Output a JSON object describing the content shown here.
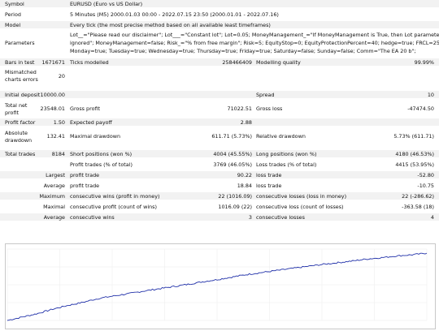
{
  "report": {
    "symbol_label": "Symbol",
    "symbol_value": "EURUSD (Euro vs US Dollar)",
    "period_label": "Period",
    "period_value": "5 Minutes (M5) 2000.01.03 00:00 - 2022.07.15 23:50 (2000.01.01 - 2022.07.16)",
    "model_label": "Model",
    "model_value": "Every tick (the most precise method based on all available least timeframes)",
    "parameters_label": "Parameters",
    "parameters_lines": [
      "Lot__=\"Please read our disclaimer\"; Lot___=\"Constant lot\"; Lot=0.05; MoneyManagement_=\"If MoneyManagement is True, then Lot parameter",
      "ignored\"; MoneyManagement=false; Risk_=\"% from free margin\"; Risk=5; EquityStop=0; EquityProtectionPercent=40; hedge=true; FRCL=25;",
      "Monday=true; Tuesday=true; Wednesday=true; Thursday=true; Friday=true; Saturday=false; Sunday=false; Comm=\"The EA 20 b\";"
    ],
    "bars_label": "Bars in test",
    "bars_value": "1671671",
    "ticks_label": "Ticks modelled",
    "ticks_value": "258466409",
    "quality_label": "Modelling quality",
    "quality_value": "99.99%",
    "mismatch_label_1": "Mismatched",
    "mismatch_label_2": "charts errors",
    "mismatch_value": "20",
    "deposit_label": "Initial deposit",
    "deposit_value": "10000.00",
    "spread_label": "Spread",
    "spread_value": "10",
    "netprofit_label_1": "Total net",
    "netprofit_label_2": "profit",
    "netprofit_value": "23548.01",
    "grossprofit_label": "Gross profit",
    "grossprofit_value": "71022.51",
    "grossloss_label": "Gross loss",
    "grossloss_value": "-47474.50",
    "pf_label": "Profit factor",
    "pf_value": "1.50",
    "payoff_label": "Expected payoff",
    "payoff_value": "2.88",
    "absdd_label_1": "Absolute",
    "absdd_label_2": "drawdown",
    "absdd_value": "132.41",
    "maxdd_label": "Maximal drawdown",
    "maxdd_value": "611.71 (5.73%)",
    "reldd_label": "Relative drawdown",
    "reldd_value": "5.73% (611.71)",
    "trades_label": "Total trades",
    "trades_value": "8184",
    "short_label": "Short positions (won %)",
    "short_value": "4004 (45.55%)",
    "long_label": "Long positions (won %)",
    "long_value": "4180 (46.53%)",
    "proftr_label": "Profit trades (% of total)",
    "proftr_value": "3769 (46.05%)",
    "losstr_label": "Loss trades (% of total)",
    "losstr_value": "4415 (53.95%)",
    "largest_label": "Largest",
    "largest_profit_label": "profit trade",
    "largest_profit_value": "90.22",
    "largest_loss_label": "loss trade",
    "largest_loss_value": "-52.80",
    "average_label": "Average",
    "average_profit_label": "profit trade",
    "average_profit_value": "18.84",
    "average_loss_label": "loss trade",
    "average_loss_value": "-10.75",
    "maximum_label": "Maximum",
    "max_wins_label": "consecutive wins (profit in money)",
    "max_wins_value": "22 (1016.09)",
    "max_losses_label": "consecutive losses (loss in money)",
    "max_losses_value": "22 (-286.62)",
    "maximal_label": "Maximal",
    "mxl_profit_label": "consecutive profit (count of wins)",
    "mxl_profit_value": "1016.09 (22)",
    "mxl_loss_label": "consecutive loss (count of losses)",
    "mxl_loss_value": "-363.58 (18)",
    "avg2_label": "Average",
    "avg_wins_label": "consecutive wins",
    "avg_wins_value": "3",
    "avg_losses_label": "consecutive losses",
    "avg_losses_value": "4"
  },
  "chart_data": {
    "type": "line",
    "series": [
      {
        "values": [
          0,
          1200,
          2400,
          3900,
          5200,
          6300,
          7600,
          8500,
          9300,
          10200,
          11000,
          11800,
          12600,
          13500,
          14300,
          15200,
          16100,
          16800,
          17500,
          18200,
          18900,
          19600,
          20200,
          20800,
          21500,
          22000,
          22600,
          23000,
          23548
        ]
      }
    ],
    "ylim": [
      0,
      25000
    ],
    "line_color": "#1f2fa8"
  }
}
